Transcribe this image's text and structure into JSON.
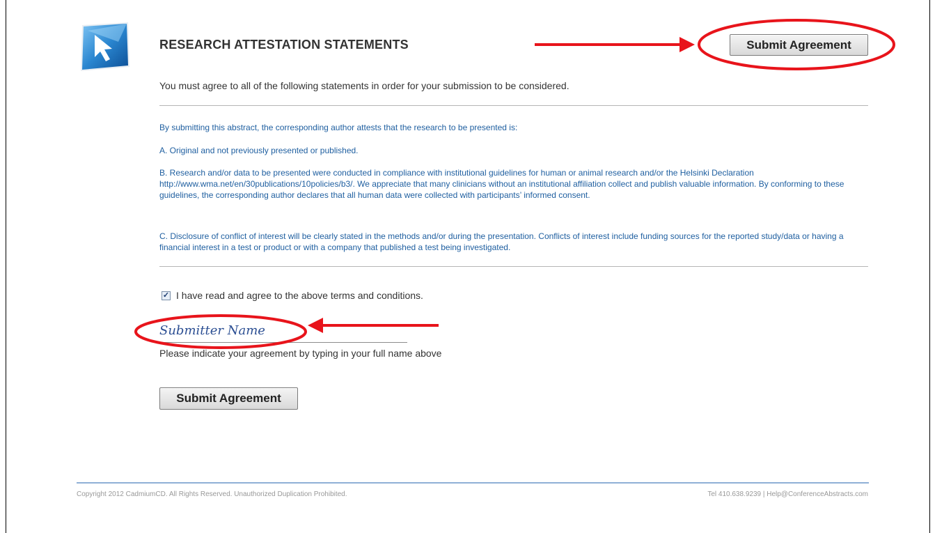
{
  "header": {
    "title": "RESEARCH ATTESTATION STATEMENTS",
    "submit_label": "Submit Agreement"
  },
  "intro": "You must agree to all of the following statements in order for your submission to be considered.",
  "terms": {
    "lead": "By submitting this abstract, the corresponding author attests that the research to be presented is:",
    "a": "A. Original and not previously presented or published.",
    "b": "B. Research and/or data to be presented were conducted in compliance with institutional guidelines for human or animal research and/or the Helsinki Declaration http://www.wma.net/en/30publications/10policies/b3/. We appreciate that many clinicians without an institutional affiliation collect and publish valuable information. By conforming to these guidelines, the corresponding author declares that all human data were collected with participants’ informed consent.",
    "c": "C. Disclosure of conflict of interest will be clearly stated in the methods and/or during the presentation. Conflicts of interest include funding sources for the reported study/data or having a financial interest in a test or product or with a company that published a test being investigated."
  },
  "agreement": {
    "checked": true,
    "label": "I have read and agree to the above terms and conditions.",
    "name_value": "Submitter Name",
    "name_hint": "Please indicate your agreement by typing in your full name above",
    "submit_label": "Submit Agreement"
  },
  "footer": {
    "copyright": "Copyright 2012 CadmiumCD. All Rights Reserved. Unauthorized Duplication Prohibited.",
    "contact": "Tel 410.638.9239  |  Help@ConferenceAbstracts.com"
  },
  "colors": {
    "annotation_red": "#e8141b",
    "terms_blue": "#1f5fa0",
    "logo_blue": "#2a86d0"
  },
  "icons": {
    "logo": "cursor-arrow-logo-icon",
    "checkbox": "checkmark-icon"
  }
}
